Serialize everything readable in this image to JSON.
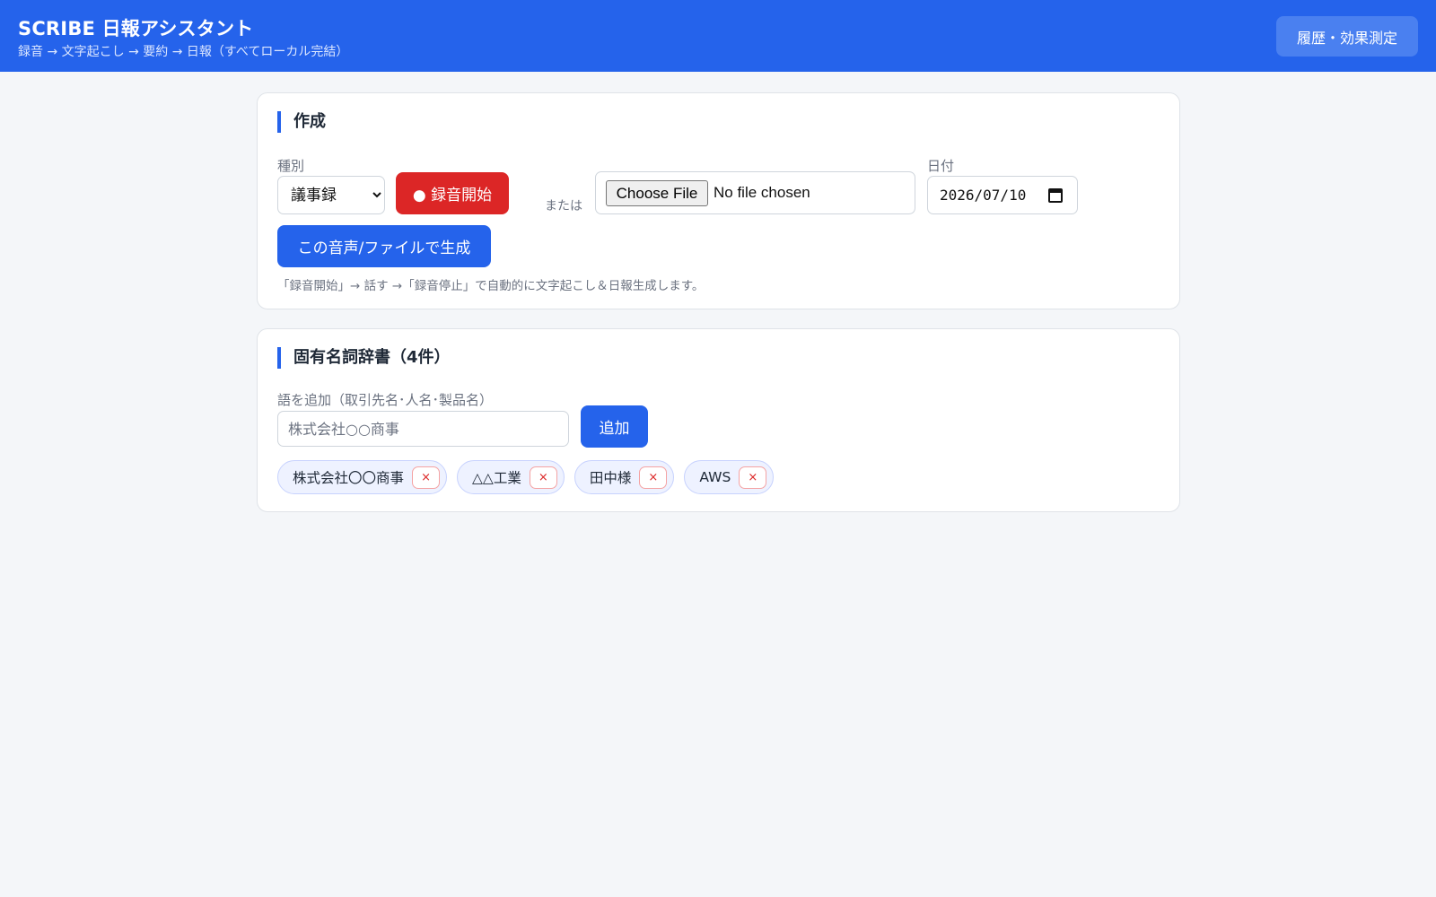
{
  "header": {
    "title": "SCRIBE 日報アシスタント",
    "subtitle": "録音 → 文字起こし → 要約 → 日報（すべてローカル完結）",
    "history_button": "履歴・効果測定"
  },
  "create": {
    "title": "作成",
    "type_label": "種別",
    "type_value": "議事録",
    "record_button": "● 録音開始",
    "or_text": "または",
    "file_button": "Choose File",
    "file_status": "No file chosen",
    "date_label": "日付",
    "date_value": "2026/07/10",
    "generate_button": "この音声/ファイルで生成",
    "help_text": "「録音開始」→ 話す →「録音停止」で自動的に文字起こし＆日報生成します。"
  },
  "dictionary": {
    "title": "固有名詞辞書（4件）",
    "input_label": "語を追加（取引先名･人名･製品名）",
    "input_placeholder": "株式会社○○商事",
    "add_button": "追加",
    "remove_label": "×",
    "words": [
      "株式会社〇〇商事",
      "△△工業",
      "田中様",
      "AWS"
    ]
  },
  "icons": {
    "calendar": "calendar-icon",
    "remove": "close-icon"
  },
  "colors": {
    "primary": "#2563eb",
    "danger": "#dc2626",
    "background": "#f4f6f9"
  }
}
